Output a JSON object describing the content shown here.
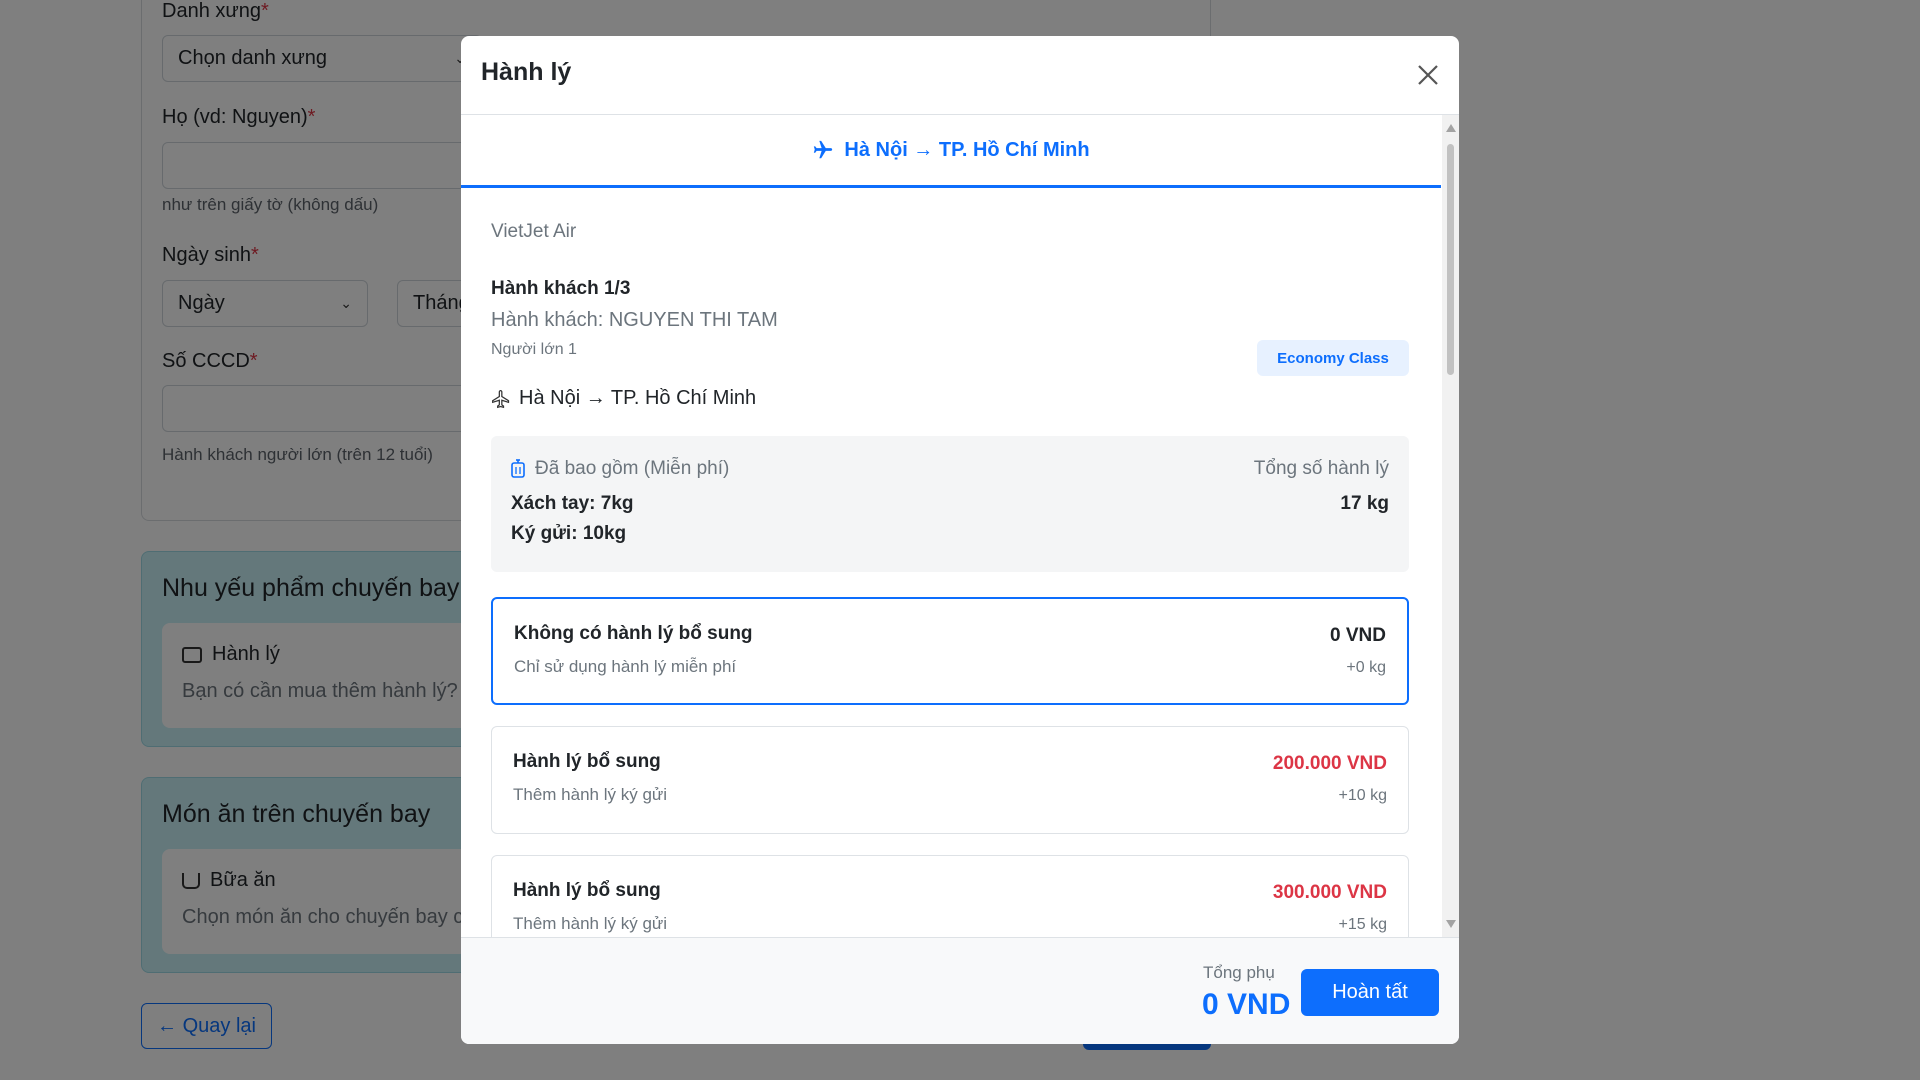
{
  "background": {
    "form": {
      "title_label": "Danh xưng",
      "title_select": "Chọn danh xưng",
      "lastname_label": "Họ (vd: Nguyen)",
      "lastname_help": "như trên giấy tờ (không dấu)",
      "dob_label": "Ngày sinh",
      "dob_day": "Ngày",
      "dob_month": "Tháng",
      "id_label": "Số CCCD",
      "id_help": "Hành khách người lớn (trên 12 tuổi)",
      "required_mark": "*"
    },
    "flight_needs": {
      "title": "Nhu yếu phẩm chuyến bay",
      "item_label": "Hành lý",
      "item_desc": "Bạn có cần mua thêm hành lý?"
    },
    "meals": {
      "title": "Món ăn trên chuyến bay",
      "item_label": "Bữa ăn",
      "item_desc": "Chọn món ăn cho chuyến bay c"
    },
    "back_button": "← Quay lại"
  },
  "modal": {
    "title": "Hành lý",
    "route_tab": "Hà Nội → TP. Hồ Chí Minh",
    "airline": "VietJet Air",
    "passenger": {
      "index": "Hành khách 1/3",
      "name": "Hành khách: NGUYEN THI TAM",
      "type": "Người lớn 1",
      "class_badge": "Economy Class"
    },
    "leg_route": "Hà Nội → TP. Hồ Chí Minh",
    "included": {
      "label": "Đã bao gồm (Miễn phí)",
      "carry_on": "Xách tay: 7kg",
      "checked": "Ký gửi: 10kg",
      "total_label": "Tổng số hành lý",
      "total_value": "17 kg"
    },
    "options": [
      {
        "title": "Không có hành lý bổ sung",
        "desc": "Chỉ sử dụng hành lý miễn phí",
        "price": "0 VND",
        "kg": "+0 kg",
        "selected": true
      },
      {
        "title": "Hành lý bổ sung",
        "desc": "Thêm hành lý ký gửi",
        "price": "200.000 VND",
        "kg": "+10 kg",
        "selected": false
      },
      {
        "title": "Hành lý bổ sung",
        "desc": "Thêm hành lý ký gửi",
        "price": "300.000 VND",
        "kg": "+15 kg",
        "selected": false
      }
    ],
    "footer": {
      "subtotal_label": "Tổng phụ",
      "subtotal_value": "0 VND",
      "done_button": "Hoàn tất"
    }
  },
  "colors": {
    "primary": "#0d6efd",
    "price_red": "#dc3545",
    "badge_bg": "#e7f1ff",
    "service_card_bg": "#c9f0f7"
  }
}
